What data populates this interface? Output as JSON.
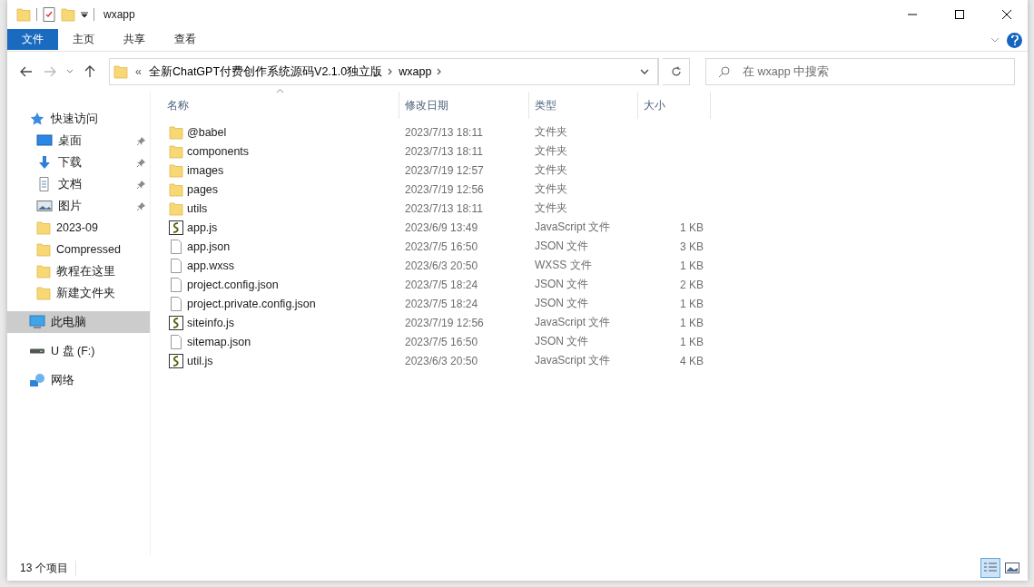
{
  "window": {
    "title": "wxapp"
  },
  "ribbon": {
    "tabs": [
      {
        "label": "文件",
        "selected": true
      },
      {
        "label": "主页",
        "selected": false
      },
      {
        "label": "共享",
        "selected": false
      },
      {
        "label": "查看",
        "selected": false
      }
    ]
  },
  "address": {
    "overflow": "«",
    "crumbs": [
      "全新ChatGPT付费创作系统源码V2.1.0独立版",
      "wxapp"
    ]
  },
  "search": {
    "placeholder": "在 wxapp 中搜索"
  },
  "sidebar": {
    "items": [
      {
        "label": "快速访问",
        "kind": "star",
        "selected": false,
        "children": [
          {
            "label": "桌面",
            "kind": "desktop",
            "pinned": true,
            "selected": false
          },
          {
            "label": "下载",
            "kind": "download",
            "pinned": true,
            "selected": false
          },
          {
            "label": "文档",
            "kind": "document",
            "pinned": true,
            "selected": false
          },
          {
            "label": "图片",
            "kind": "picture",
            "pinned": true,
            "selected": false
          },
          {
            "label": "2023-09",
            "kind": "folder",
            "pinned": false,
            "selected": false
          },
          {
            "label": "Compressed",
            "kind": "folder",
            "pinned": false,
            "selected": false
          },
          {
            "label": "教程在这里",
            "kind": "folder",
            "pinned": false,
            "selected": false
          },
          {
            "label": "新建文件夹",
            "kind": "folder",
            "pinned": false,
            "selected": false
          }
        ]
      },
      {
        "label": "此电脑",
        "kind": "computer",
        "selected": true
      },
      {
        "label": "U 盘 (F:)",
        "kind": "drive",
        "selected": false
      },
      {
        "label": "网络",
        "kind": "network",
        "selected": false
      }
    ]
  },
  "columns": [
    {
      "label": "名称",
      "sorted": true
    },
    {
      "label": "修改日期",
      "sorted": false
    },
    {
      "label": "类型",
      "sorted": false
    },
    {
      "label": "大小",
      "sorted": false
    }
  ],
  "files": [
    {
      "name": "@babel",
      "kind": "folder",
      "modified": "2023/7/13 18:11",
      "type": "文件夹"
    },
    {
      "name": "components",
      "kind": "folder",
      "modified": "2023/7/13 18:11",
      "type": "文件夹"
    },
    {
      "name": "images",
      "kind": "folder",
      "modified": "2023/7/19 12:57",
      "type": "文件夹"
    },
    {
      "name": "pages",
      "kind": "folder",
      "modified": "2023/7/19 12:56",
      "type": "文件夹"
    },
    {
      "name": "utils",
      "kind": "folder",
      "modified": "2023/7/13 18:11",
      "type": "文件夹"
    },
    {
      "name": "app.js",
      "kind": "script",
      "modified": "2023/6/9 13:49",
      "type": "JavaScript 文件",
      "size": "1 KB"
    },
    {
      "name": "app.json",
      "kind": "file",
      "modified": "2023/7/5 16:50",
      "type": "JSON 文件",
      "size": "3 KB"
    },
    {
      "name": "app.wxss",
      "kind": "file",
      "modified": "2023/6/3 20:50",
      "type": "WXSS 文件",
      "size": "1 KB"
    },
    {
      "name": "project.config.json",
      "kind": "file",
      "modified": "2023/7/5 18:24",
      "type": "JSON 文件",
      "size": "2 KB"
    },
    {
      "name": "project.private.config.json",
      "kind": "file",
      "modified": "2023/7/5 18:24",
      "type": "JSON 文件",
      "size": "1 KB"
    },
    {
      "name": "siteinfo.js",
      "kind": "script",
      "modified": "2023/7/19 12:56",
      "type": "JavaScript 文件",
      "size": "1 KB"
    },
    {
      "name": "sitemap.json",
      "kind": "file",
      "modified": "2023/7/5 16:50",
      "type": "JSON 文件",
      "size": "1 KB"
    },
    {
      "name": "util.js",
      "kind": "script",
      "modified": "2023/6/3 20:50",
      "type": "JavaScript 文件",
      "size": "4 KB"
    }
  ],
  "status_bar": {
    "count": "13 个项目",
    "views": [
      {
        "kind": "details",
        "selected": true
      },
      {
        "kind": "preview",
        "selected": false
      }
    ]
  }
}
